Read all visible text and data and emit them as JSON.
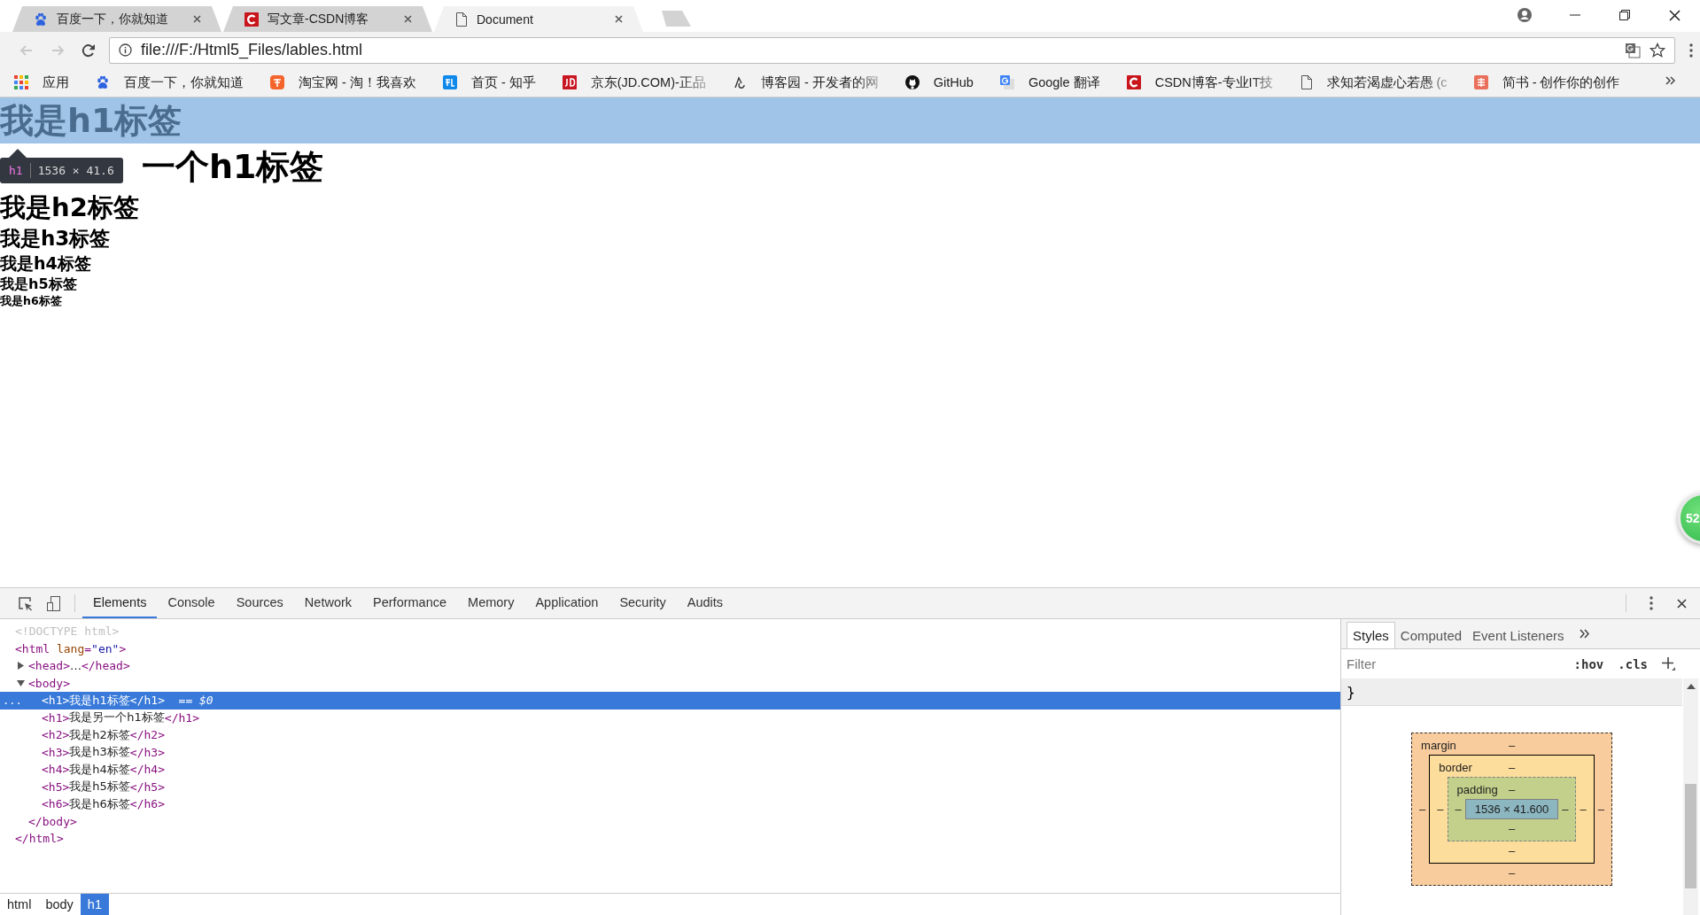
{
  "browser_tabs": [
    {
      "title": "百度一下，你就知道",
      "kind": "paw",
      "selected": false
    },
    {
      "title": "写文章-CSDN博客",
      "kind": "csdn",
      "selected": false
    },
    {
      "title": "Document",
      "kind": "page",
      "selected": true
    }
  ],
  "nav_buttons": [
    {
      "kind": "back",
      "disabled": true
    },
    {
      "kind": "forward",
      "disabled": true
    },
    {
      "kind": "reload",
      "disabled": false
    }
  ],
  "address": {
    "value": "file:///F:/Html5_Files/lables.html"
  },
  "bookmarks": [
    {
      "label": "应用",
      "kind": "apps",
      "faded": false
    },
    {
      "label": "百度一下，你就知道",
      "kind": "paw",
      "faded": false
    },
    {
      "label": "淘宝网 - 淘！我喜欢",
      "kind": "taobao",
      "faded": false
    },
    {
      "label": "首页 - 知乎",
      "kind": "zhihu",
      "faded": false
    },
    {
      "label": "京东(JD.COM)-正品",
      "kind": "jd",
      "faded": true
    },
    {
      "label": "博客园 - 开发者的网",
      "kind": "cnblogs",
      "faded": true
    },
    {
      "label": "GitHub",
      "kind": "github",
      "faded": false
    },
    {
      "label": "Google 翻译",
      "kind": "translate",
      "faded": false
    },
    {
      "label": "CSDN博客-专业IT技",
      "kind": "csdn",
      "faded": true
    },
    {
      "label": "求知若渴虚心若愚 (c",
      "kind": "page",
      "faded": true
    },
    {
      "label": "简书 - 创作你的创作",
      "kind": "jianshu",
      "faded": false
    }
  ],
  "page": {
    "headings": [
      {
        "kind": "h1",
        "text": "我是h1标签",
        "highlighted": true
      },
      {
        "kind": "h1",
        "text": "一个h1标签",
        "highlighted": false
      },
      {
        "kind": "h2",
        "text": "我是h2标签",
        "highlighted": false
      },
      {
        "kind": "h3",
        "text": "我是h3标签",
        "highlighted": false
      },
      {
        "kind": "h4",
        "text": "我是h4标签",
        "highlighted": false
      },
      {
        "kind": "h5",
        "text": "我是h5标签",
        "highlighted": false
      },
      {
        "kind": "h6",
        "text": "我是h6标签",
        "highlighted": false
      }
    ],
    "inspect_tooltip": {
      "tag": "h1",
      "size": "1536 × 41.6"
    },
    "floating_badge": "52"
  },
  "devtools": {
    "tabs": [
      {
        "label": "Elements",
        "selected": true
      },
      {
        "label": "Console",
        "selected": false
      },
      {
        "label": "Sources",
        "selected": false
      },
      {
        "label": "Network",
        "selected": false
      },
      {
        "label": "Performance",
        "selected": false
      },
      {
        "label": "Memory",
        "selected": false
      },
      {
        "label": "Application",
        "selected": false
      },
      {
        "label": "Security",
        "selected": false
      },
      {
        "label": "Audits",
        "selected": false
      }
    ],
    "tree": [
      {
        "parts": [
          {
            "kind": "doctype",
            "text": "<!DOCTYPE html>"
          }
        ],
        "selected": false
      },
      {
        "parts": [
          {
            "kind": "tag",
            "text": "<html"
          },
          {
            "kind": "attr",
            "text": "lang"
          },
          {
            "kind": "punct",
            "text": "="
          },
          {
            "kind": "value",
            "text": "\"en\""
          },
          {
            "kind": "tag",
            "text": ">"
          }
        ],
        "selected": false,
        "closing": "</html>",
        "children": [
          {
            "parts": [
              {
                "kind": "tag",
                "text": "<head>"
              },
              {
                "kind": "text",
                "text": "…"
              },
              {
                "kind": "tag",
                "text": "</head>"
              }
            ],
            "expanded": false,
            "selected": false
          },
          {
            "parts": [
              {
                "kind": "tag",
                "text": "<body>"
              }
            ],
            "expanded": true,
            "selected": false,
            "closing": "</body>",
            "children": [
              {
                "parts": [
                  {
                    "kind": "tag",
                    "text": "<h1>"
                  },
                  {
                    "kind": "text",
                    "text": "我是h1标签"
                  },
                  {
                    "kind": "tag",
                    "text": "</h1>"
                  },
                  {
                    "kind": "marker",
                    "text": "== $0"
                  }
                ],
                "selected": true,
                "row_menu": "..."
              },
              {
                "parts": [
                  {
                    "kind": "tag",
                    "text": "<h1>"
                  },
                  {
                    "kind": "text",
                    "text": "我是另一个h1标签"
                  },
                  {
                    "kind": "tag",
                    "text": "</h1>"
                  }
                ],
                "selected": false
              },
              {
                "parts": [
                  {
                    "kind": "tag",
                    "text": "<h2>"
                  },
                  {
                    "kind": "text",
                    "text": "我是h2标签"
                  },
                  {
                    "kind": "tag",
                    "text": "</h2>"
                  }
                ],
                "selected": false
              },
              {
                "parts": [
                  {
                    "kind": "tag",
                    "text": "<h3>"
                  },
                  {
                    "kind": "text",
                    "text": "我是h3标签"
                  },
                  {
                    "kind": "tag",
                    "text": "</h3>"
                  }
                ],
                "selected": false
              },
              {
                "parts": [
                  {
                    "kind": "tag",
                    "text": "<h4>"
                  },
                  {
                    "kind": "text",
                    "text": "我是h4标签"
                  },
                  {
                    "kind": "tag",
                    "text": "</h4>"
                  }
                ],
                "selected": false
              },
              {
                "parts": [
                  {
                    "kind": "tag",
                    "text": "<h5>"
                  },
                  {
                    "kind": "text",
                    "text": "我是h5标签"
                  },
                  {
                    "kind": "tag",
                    "text": "</h5>"
                  }
                ],
                "selected": false
              },
              {
                "parts": [
                  {
                    "kind": "tag",
                    "text": "<h6>"
                  },
                  {
                    "kind": "text",
                    "text": "我是h6标签"
                  },
                  {
                    "kind": "tag",
                    "text": "</h6>"
                  }
                ],
                "selected": false
              }
            ]
          }
        ]
      }
    ],
    "breadcrumbs": [
      {
        "label": "html",
        "selected": false
      },
      {
        "label": "body",
        "selected": false
      },
      {
        "label": "h1",
        "selected": true
      }
    ],
    "styles": {
      "tabs": [
        {
          "label": "Styles",
          "selected": true
        },
        {
          "label": "Computed",
          "selected": false
        },
        {
          "label": "Event Listeners",
          "selected": false
        }
      ],
      "filter_placeholder": "Filter",
      "toggles": [
        ":hov",
        ".cls"
      ],
      "rule_end": "}",
      "box_model": {
        "top_rows": [
          {
            "label": "margin",
            "top": "–"
          },
          {
            "label": "border",
            "top": "–"
          },
          {
            "label": "padding",
            "top": "–"
          }
        ],
        "left_values": [
          "–",
          "–",
          "–"
        ],
        "content": "1536 × 41.600",
        "right_values": [
          "–",
          "–",
          "–"
        ],
        "bottom_values": [
          "–",
          "–",
          "–"
        ]
      }
    }
  }
}
